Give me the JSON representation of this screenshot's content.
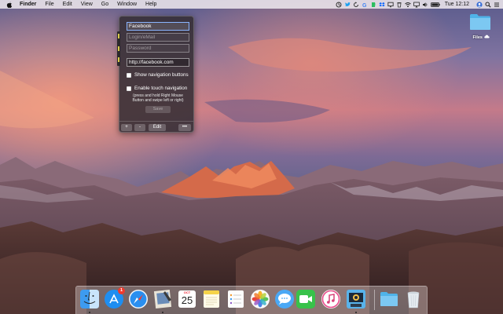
{
  "menubar": {
    "app_name": "Finder",
    "menus": [
      "File",
      "Edit",
      "View",
      "Go",
      "Window",
      "Help"
    ],
    "status": {
      "clock": "Tue 12:12"
    }
  },
  "popup": {
    "title_value": "Facebook",
    "login_placeholder": "Login/eMail",
    "password_placeholder": "Password",
    "url_value": "http://facebook.com",
    "show_nav_label": "Show navigation buttons",
    "touch_nav_label": "Enable touch navigation",
    "touch_hint": "(press and hold Right Mouse Button and swipe left or right)",
    "save_label": "Save",
    "add_label": "+",
    "remove_label": "-",
    "edit_label": "Edit",
    "more_label": "•••",
    "show_nav_checked": false,
    "touch_nav_checked": false
  },
  "desktop": {
    "folder_label": "Files"
  },
  "dock": {
    "app_store_badge": "1",
    "calendar_month": "OCT",
    "calendar_day": "25",
    "items": [
      "finder",
      "app-store",
      "safari",
      "preview",
      "calendar",
      "notes",
      "reminders",
      "photos",
      "messages",
      "facetime",
      "itunes",
      "image-capture",
      "folder",
      "trash"
    ]
  },
  "colors": {
    "menubar_bg": "#ece6ec",
    "popup_bg": "#342e34",
    "focus_ring": "#8ab4ff",
    "badge": "#f03a2e"
  }
}
